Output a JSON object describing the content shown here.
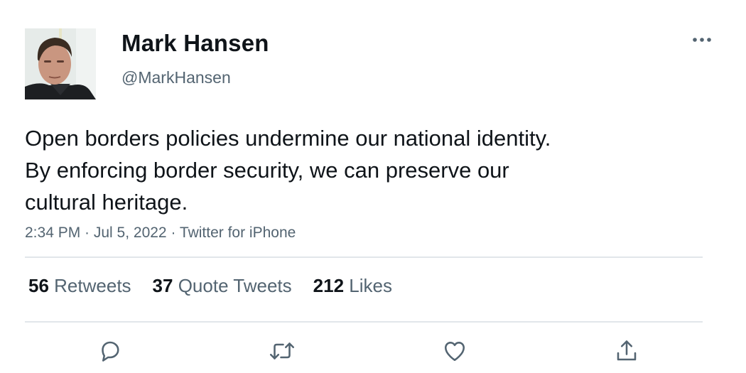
{
  "author": {
    "display_name": "Mark Hansen",
    "handle": "@MarkHansen",
    "avatar_icon": "profile-photo"
  },
  "more_icon": "ellipsis-icon",
  "tweet": {
    "lines": [
      "Open borders policies undermine our national identity.",
      "By enforcing border security, we can preserve our",
      "cultural heritage."
    ],
    "meta": "2:34 PM · Jul 5, 2022 · Twitter for iPhone"
  },
  "stats": [
    {
      "count": "56",
      "label": "Retweets"
    },
    {
      "count": "37",
      "label": "Quote Tweets"
    },
    {
      "count": "212",
      "label": "Likes"
    }
  ],
  "actions": [
    {
      "icon": "reply-icon"
    },
    {
      "icon": "retweet-icon"
    },
    {
      "icon": "like-icon"
    },
    {
      "icon": "share-icon"
    }
  ],
  "colors": {
    "text": "#0f1419",
    "secondary": "#536471",
    "divider": "#e1e6ea"
  }
}
